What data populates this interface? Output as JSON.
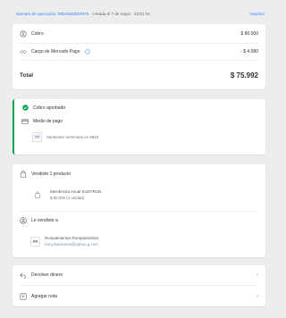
{
  "header": {
    "operation_link": "Número de operación 79824525557976",
    "created": " · Creada el 7 de mayo · 23:01 hs",
    "print_label": "Imprimir"
  },
  "summary": {
    "cobro_label": "Cobro",
    "cobro_value": "$ 80.000",
    "cargo_label": "Cargo de Mercado Pago",
    "cargo_value": "- $ 4.080",
    "total_label": "Total",
    "total_value": "$ 75.992"
  },
  "status": {
    "approved_label": "Cobro aprobado",
    "payment_method_title": "Medio de pago",
    "payment_method_value": "Santander terminada en 5963"
  },
  "seller": {
    "title": "Vendiste 1 producto",
    "product_name": "Membresía Anual SUDYRUN",
    "product_detail": "$ 80.000 (1 unidad)"
  },
  "buyer": {
    "title": "Le vendiste a",
    "name": "Rompamientos Rompamientos",
    "email": "romy.barrientos@yahoo.g.com"
  },
  "actions": {
    "refund_label": "Devolver dinero",
    "note_label": "Agregar nota"
  }
}
